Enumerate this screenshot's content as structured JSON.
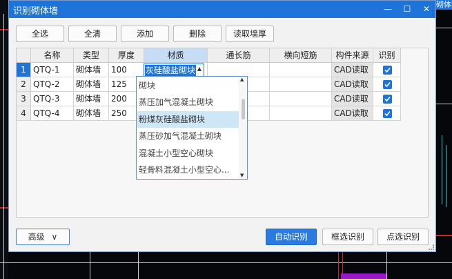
{
  "dialog": {
    "title": "识别砌体墙",
    "win_min": "—",
    "win_max": "☐",
    "win_close": "✕"
  },
  "bg_title_fragment": "砌体墙",
  "toolbar": {
    "select_all": "全选",
    "clear_all": "全清",
    "add": "添加",
    "delete": "删除",
    "read_thickness": "读取墙厚"
  },
  "table": {
    "headers": [
      "名称",
      "类型",
      "厚度",
      "材质",
      "通长筋",
      "横向短筋",
      "构件来源",
      "识别"
    ],
    "rows": [
      {
        "num": "1",
        "name": "QTQ-1",
        "type": "砌体墙",
        "thickness": "100",
        "material": "灰硅酸盐砌块",
        "source": "CAD读取",
        "checked": true
      },
      {
        "num": "2",
        "name": "QTQ-2",
        "type": "砌体墙",
        "thickness": "125",
        "material": "",
        "source": "CAD读取",
        "checked": true
      },
      {
        "num": "3",
        "name": "QTQ-3",
        "type": "砌体墙",
        "thickness": "200",
        "material": "",
        "source": "CAD读取",
        "checked": true
      },
      {
        "num": "4",
        "name": "QTQ-4",
        "type": "砌体墙",
        "thickness": "250",
        "material": "",
        "source": "CAD读取",
        "checked": true
      }
    ]
  },
  "dropdown": {
    "options": [
      "砌块",
      "蒸压加气混凝土砌块",
      "粉煤灰硅酸盐砌块",
      "蒸压砂加气混凝土砌块",
      "混凝土小型空心砌块",
      "轻骨料混凝土小型空心..."
    ],
    "highlighted_index": 2,
    "arrow_up": "▲",
    "arrow_down": "▼"
  },
  "edit_arrow": "▲",
  "bottom": {
    "advanced": "高级",
    "advanced_chevron": "∨",
    "auto_identify": "自动识别",
    "box_identify": "框选识别",
    "point_identify": "点选识别"
  },
  "colors": {
    "accent": "#1f74d9",
    "highlight": "#cfe6f7"
  }
}
